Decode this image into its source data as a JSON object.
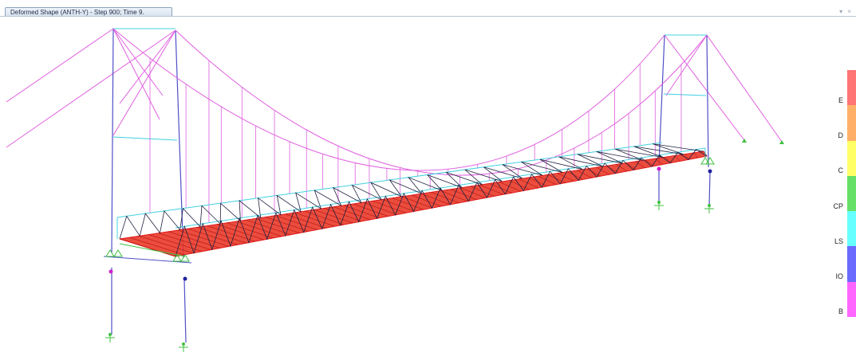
{
  "window": {
    "tab_title": "Deformed Shape (ANTH-Y) - Step 900; Time 9.",
    "controls": "▾ ×"
  },
  "legend": {
    "items": [
      {
        "label": "E",
        "color": "#ff7474"
      },
      {
        "label": "D",
        "color": "#ffb068"
      },
      {
        "label": "C",
        "color": "#ffff66"
      },
      {
        "label": "CP",
        "color": "#66e066"
      },
      {
        "label": "LS",
        "color": "#66ffff"
      },
      {
        "label": "IO",
        "color": "#6a6aff"
      },
      {
        "label": "B",
        "color": "#ff66ff"
      }
    ]
  },
  "colors": {
    "cable": "#e060e0",
    "tower": "#5050c8",
    "beam": "#40d0e0",
    "truss": "#202040",
    "deck": "#e00000",
    "support": "#40c040",
    "hinge_magenta": "#d020d0",
    "hinge_blue": "#2020a0"
  }
}
